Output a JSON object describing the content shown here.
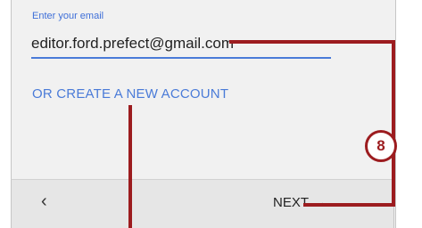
{
  "form": {
    "email_label": "Enter your email",
    "email_value": "editor.ford.prefect@gmail.com",
    "create_account_link": "OR CREATE A NEW ACCOUNT"
  },
  "nav": {
    "back_icon": "chevron-left-icon",
    "back_glyph": "‹",
    "next_label": "NEXT",
    "next_icon": "arrow-right-icon",
    "next_glyph": "→"
  },
  "callout": {
    "step_number": "8",
    "color": "#9c1c1f"
  },
  "colors": {
    "accent": "#4a7bd8",
    "screen_bg": "#f1f1f1",
    "bottom_bar_bg": "#e6e6e6"
  }
}
